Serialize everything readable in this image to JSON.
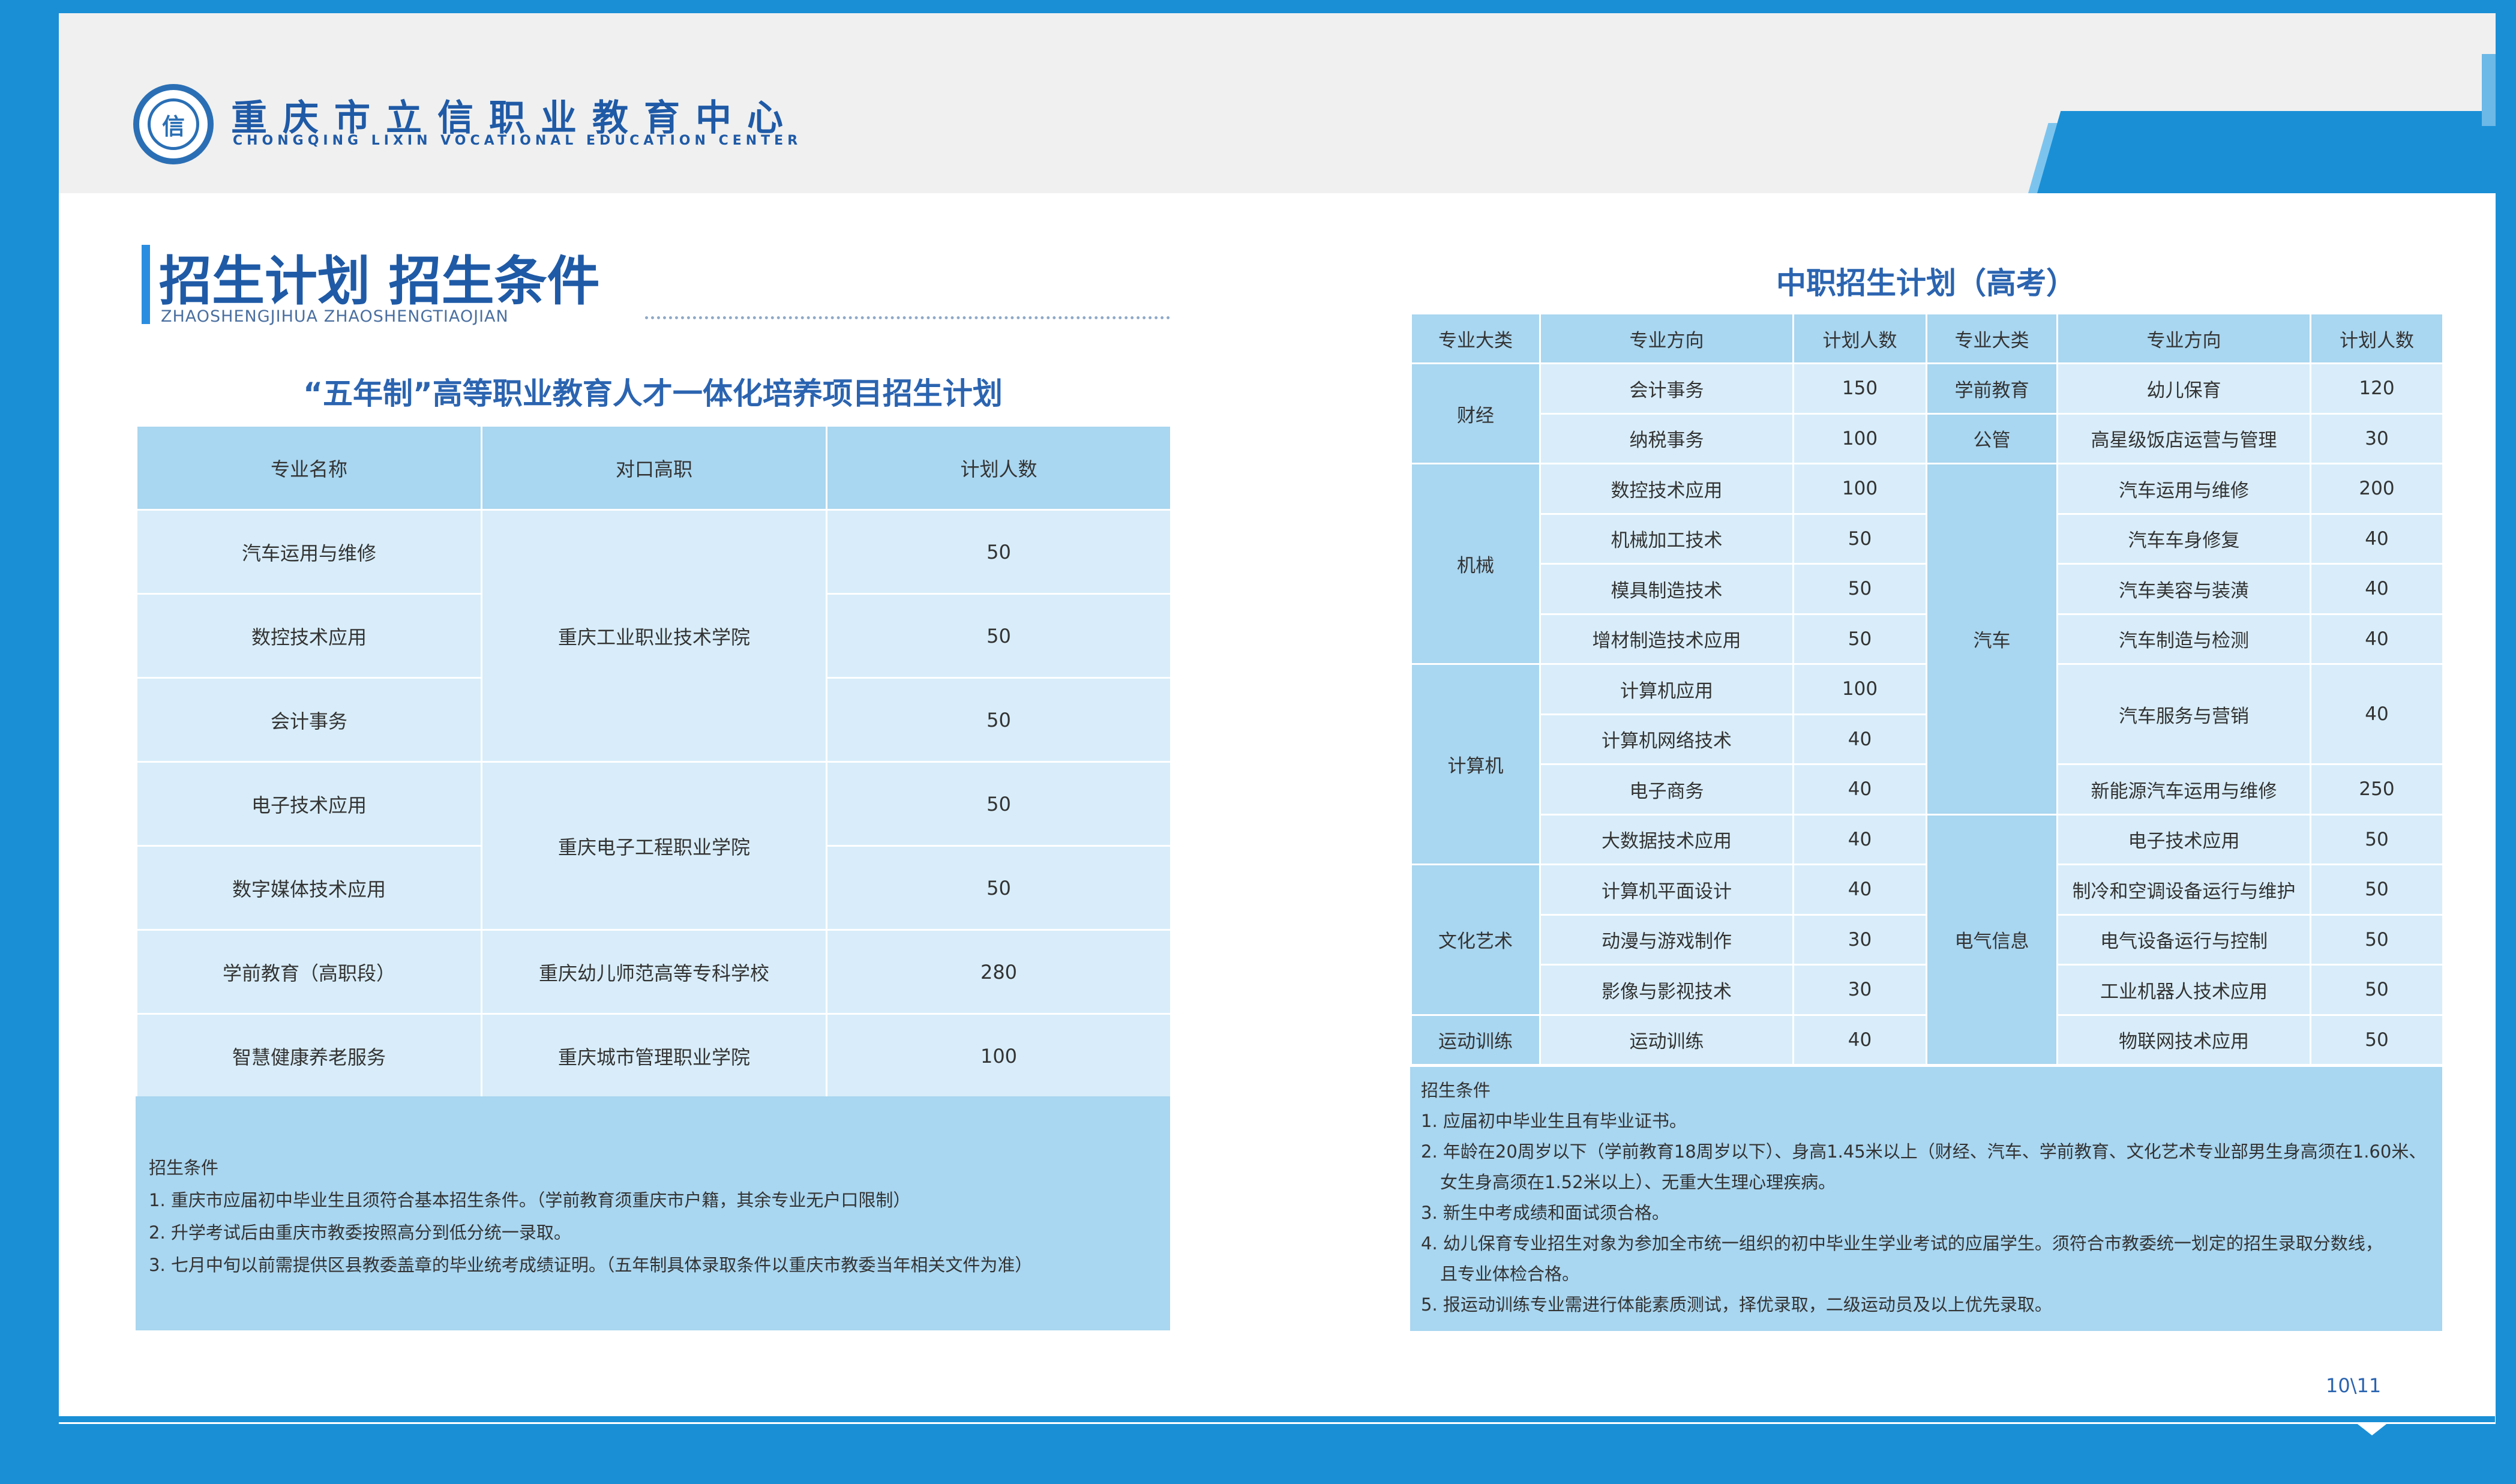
{
  "header": {
    "org_name_cn": "重庆市立信职业教育中心",
    "org_name_en": "CHONGQING LIXIN VOCATIONAL EDUCATION CENTER",
    "logo_glyph": "信"
  },
  "section": {
    "title": "招生计划 招生条件",
    "subtitle": "ZHAOSHENGJIHUA ZHAOSHENGTIAOJIAN"
  },
  "left": {
    "heading": "“五年制”高等职业教育人才一体化培养项目招生计划",
    "columns": [
      "专业名称",
      "对口高职",
      "计划人数"
    ],
    "rows": [
      {
        "major": "汽车运用与维修",
        "count": "50"
      },
      {
        "major": "数控技术应用",
        "count": "50"
      },
      {
        "major": "会计事务",
        "count": "50"
      },
      {
        "major": "电子技术应用",
        "count": "50"
      },
      {
        "major": "数字媒体技术应用",
        "count": "50"
      },
      {
        "major": "学前教育（高职段）",
        "count": "280"
      },
      {
        "major": "智慧健康养老服务",
        "count": "100"
      }
    ],
    "colleges": [
      "重庆工业职业技术学院",
      "重庆电子工程职业学院",
      "重庆幼儿师范高等专科学校",
      "重庆城市管理职业学院"
    ],
    "conditions_title": "招生条件",
    "conditions": [
      "1. 重庆市应届初中毕业生且须符合基本招生条件。（学前教育须重庆市户籍，其余专业无户口限制）",
      "2. 升学考试后由重庆市教委按照高分到低分统一录取。",
      "3. 七月中旬以前需提供区县教委盖章的毕业统考成绩证明。（五年制具体录取条件以重庆市教委当年相关文件为准）"
    ]
  },
  "right": {
    "heading": "中职招生计划（高考）",
    "columns": [
      "专业大类",
      "专业方向",
      "计划人数",
      "专业大类",
      "专业方向",
      "计划人数"
    ],
    "left_categories": [
      "财经",
      "机械",
      "计算机",
      "文化艺术",
      "运动训练"
    ],
    "left_rows": [
      {
        "direction": "会计事务",
        "count": "150"
      },
      {
        "direction": "纳税事务",
        "count": "100"
      },
      {
        "direction": "数控技术应用",
        "count": "100"
      },
      {
        "direction": "机械加工技术",
        "count": "50"
      },
      {
        "direction": "模具制造技术",
        "count": "50"
      },
      {
        "direction": "增材制造技术应用",
        "count": "50"
      },
      {
        "direction": "计算机应用",
        "count": "100"
      },
      {
        "direction": "计算机网络技术",
        "count": "40"
      },
      {
        "direction": "电子商务",
        "count": "40"
      },
      {
        "direction": "大数据技术应用",
        "count": "40"
      },
      {
        "direction": "计算机平面设计",
        "count": "40"
      },
      {
        "direction": "动漫与游戏制作",
        "count": "30"
      },
      {
        "direction": "影像与影视技术",
        "count": "30"
      },
      {
        "direction": "运动训练",
        "count": "40"
      }
    ],
    "right_categories": [
      "学前教育",
      "公管",
      "汽车",
      "电气信息"
    ],
    "right_rows": [
      {
        "direction": "幼儿保育",
        "count": "120"
      },
      {
        "direction": "高星级饭店运营与管理",
        "count": "30"
      },
      {
        "direction": "汽车运用与维修",
        "count": "200"
      },
      {
        "direction": "汽车车身修复",
        "count": "40"
      },
      {
        "direction": "汽车美容与装潢",
        "count": "40"
      },
      {
        "direction": "汽车制造与检测",
        "count": "40"
      },
      {
        "direction": "汽车服务与营销",
        "count": "40"
      },
      {
        "direction": "新能源汽车运用与维修",
        "count": "250"
      },
      {
        "direction": "电子技术应用",
        "count": "50"
      },
      {
        "direction": "制冷和空调设备运行与维护",
        "count": "50"
      },
      {
        "direction": "电气设备运行与控制",
        "count": "50"
      },
      {
        "direction": "工业机器人技术应用",
        "count": "50"
      },
      {
        "direction": "物联网技术应用",
        "count": "50"
      }
    ],
    "conditions_title": "招生条件",
    "conditions": [
      "1. 应届初中毕业生且有毕业证书。",
      "2. 年龄在20周岁以下（学前教育18周岁以下）、身高1.45米以上（财经、汽车、学前教育、文化艺术专业部男生身高须在1.60米、",
      "女生身高须在1.52米以上）、无重大生理心理疾病。",
      "3. 新生中考成绩和面试须合格。",
      "4. 幼儿保育专业招生对象为参加全市统一组织的初中毕业生学业考试的应届学生。须符合市教委统一划定的招生录取分数线，",
      "且专业体检合格。",
      "5. 报运动训练专业需进行体能素质测试，择优录取，二级运动员及以上优先录取。"
    ]
  },
  "footer": {
    "page_number": "10\\11"
  },
  "colors": {
    "frame_blue": "#1a8fd6",
    "title_blue": "#1f5aa6",
    "header_cell": "#a9d6f0",
    "body_cell": "#d8edf9"
  }
}
